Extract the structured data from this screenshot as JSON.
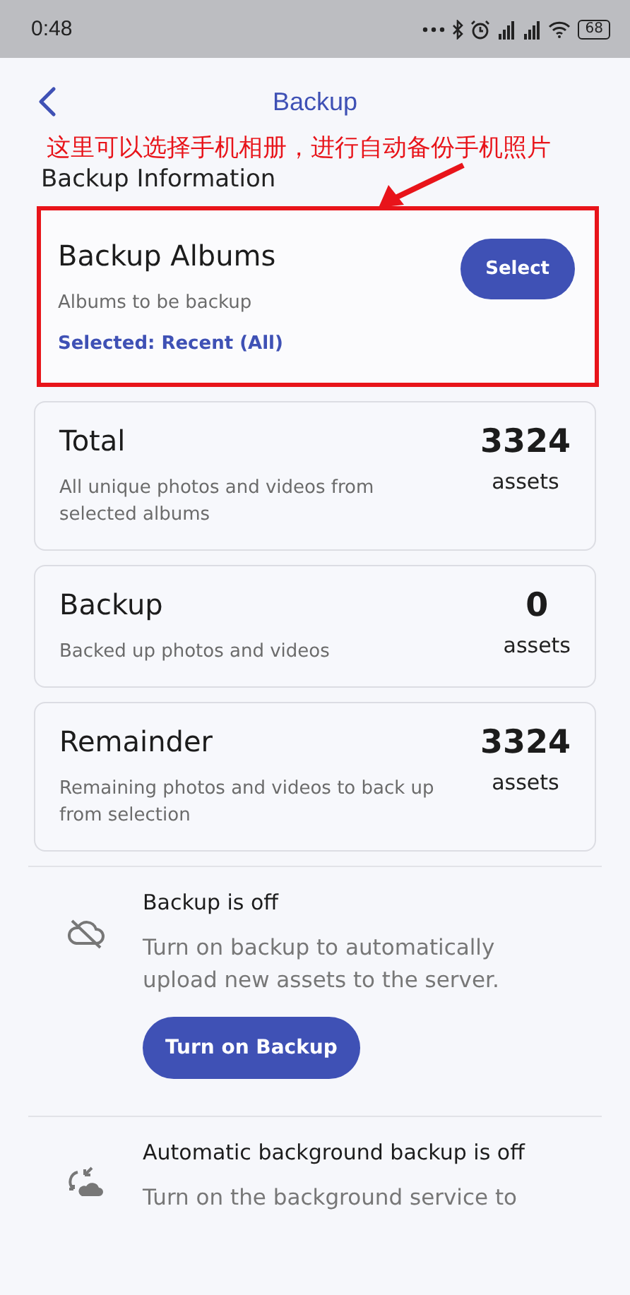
{
  "status_bar": {
    "time": "0:48",
    "battery": "68"
  },
  "header": {
    "title": "Backup"
  },
  "annotation": {
    "text": "这里可以选择手机相册，进行自动备份手机照片"
  },
  "section_title": "Backup Information",
  "cards": [
    {
      "kind": "albums",
      "title": "Backup Albums",
      "subtitle": "Albums to be backup",
      "selected_text": "Selected: Recent (All)",
      "button": "Select",
      "highlighted": true
    },
    {
      "kind": "count",
      "title": "Total",
      "subtitle": "All unique photos and videos from selected albums",
      "count": "3324",
      "unit": "assets",
      "highlighted": false
    },
    {
      "kind": "count",
      "title": "Backup",
      "subtitle": "Backed up photos and videos",
      "count": "0",
      "unit": "assets",
      "highlighted": false
    },
    {
      "kind": "count",
      "title": "Remainder",
      "subtitle": "Remaining photos and videos to back up from selection",
      "count": "3324",
      "unit": "assets",
      "highlighted": false
    }
  ],
  "settings": [
    {
      "kind": "backup",
      "title": "Backup is off",
      "description": "Turn on backup to automatically upload new assets to the server.",
      "button": "Turn on Backup"
    },
    {
      "kind": "background",
      "title": "Automatic background backup is off",
      "description": "Turn on the background service to"
    }
  ]
}
